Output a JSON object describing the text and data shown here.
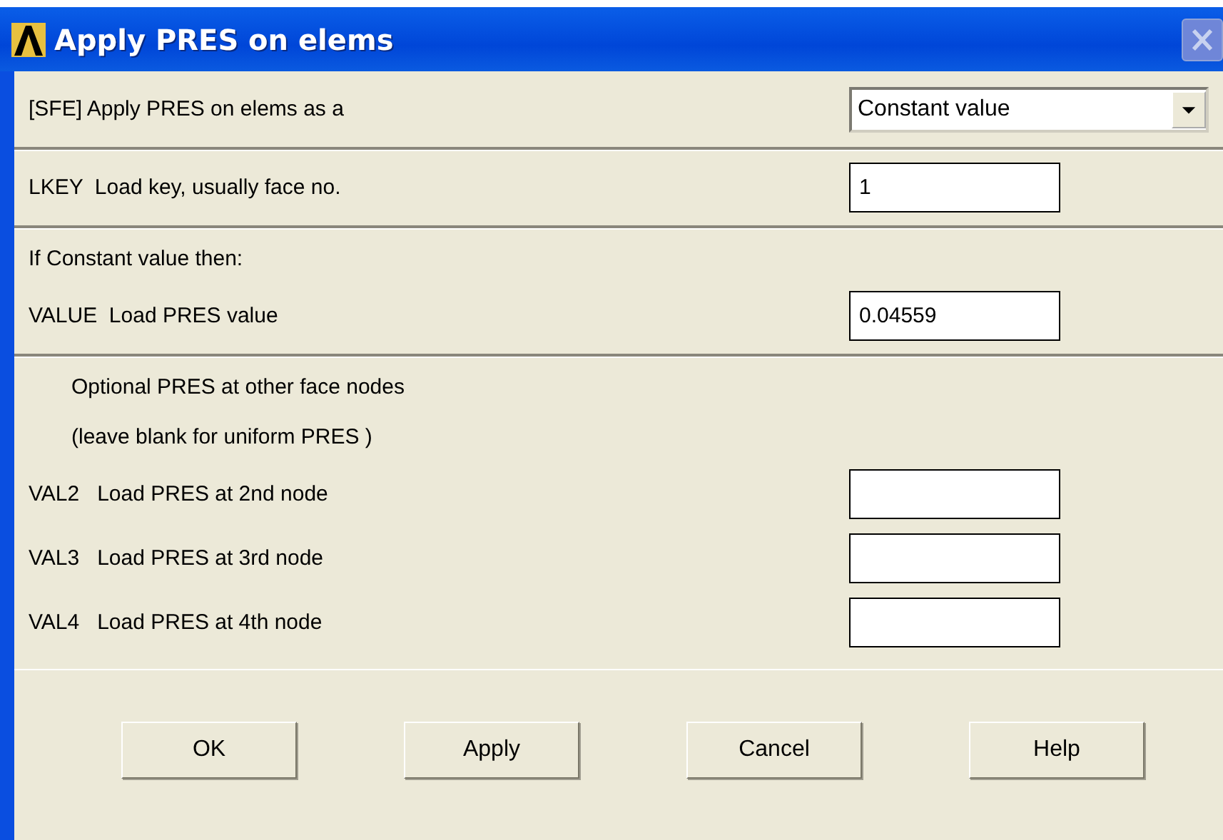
{
  "window": {
    "title": "Apply PRES on elems",
    "close_disabled": true
  },
  "sections": [
    {
      "rows": [
        {
          "kind": "dropdown",
          "label": "[SFE] Apply PRES on elems as a",
          "value": "Constant value"
        }
      ]
    },
    {
      "rows": [
        {
          "kind": "field",
          "label": "LKEY  Load key, usually face no.",
          "value": "1"
        }
      ]
    },
    {
      "rows": [
        {
          "kind": "note",
          "label": "If Constant value then:"
        },
        {
          "kind": "field",
          "label": "VALUE  Load PRES value",
          "value": "0.04559"
        }
      ]
    },
    {
      "rows": [
        {
          "kind": "indented-note",
          "label": "Optional PRES at other face nodes"
        },
        {
          "kind": "indented-note",
          "label": "(leave blank for uniform PRES )"
        },
        {
          "kind": "field",
          "label": "VAL2   Load PRES at 2nd node",
          "value": ""
        },
        {
          "kind": "field",
          "label": "VAL3   Load PRES at 3rd node",
          "value": ""
        },
        {
          "kind": "field",
          "label": "VAL4   Load PRES at 4th node",
          "value": ""
        }
      ]
    }
  ],
  "buttons": [
    "OK",
    "Apply",
    "Cancel",
    "Help"
  ]
}
